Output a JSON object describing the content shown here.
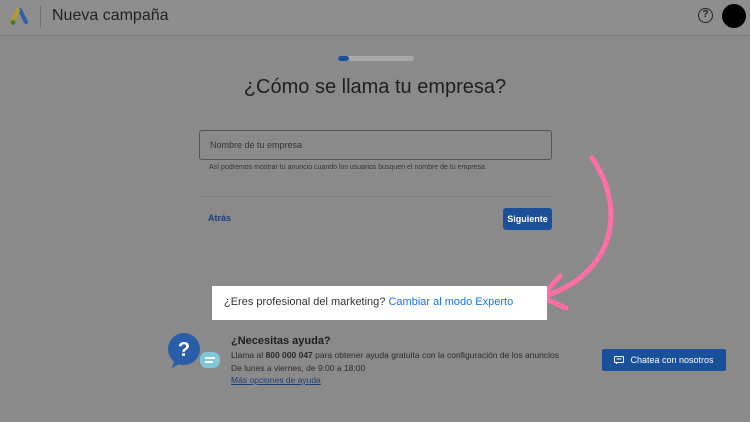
{
  "header": {
    "title": "Nueva campaña",
    "help_symbol": "?",
    "logo_icon": "google-ads-logo",
    "colors": {
      "logo_blue": "#2e5fa8",
      "logo_yellow": "#b89a2a"
    }
  },
  "progress": {
    "fraction": 0.15
  },
  "form": {
    "question": "¿Cómo se llama tu empresa?",
    "name_placeholder": "Nombre de tu empresa",
    "name_value": "",
    "hint": "Así podremos mostrar tu anuncio cuando los usuarios busquen el nombre de tu empresa",
    "back_label": "Atrás",
    "next_label": "Siguiente"
  },
  "expert": {
    "question": "¿Eres profesional del marketing?",
    "link_label": "Cambiar al modo Experto",
    "arrow_color": "#ff6ea6"
  },
  "help": {
    "title": "¿Necesitas ayuda?",
    "text_before": "Llama al ",
    "phone": "800 000 047",
    "text_after": " para obtener ayuda gratuita con la configuración de los anuncios",
    "hours": "De lunes a viernes, de 9:00 a 18:00",
    "more_link": "Más opciones de ayuda",
    "chat_label": "Chatea con nosotros",
    "bubble_symbol": "?",
    "colors": {
      "accent": "#1a4f9a",
      "bubble_blue": "#2a5ea8",
      "bubble_teal": "#7ec8d8"
    }
  }
}
